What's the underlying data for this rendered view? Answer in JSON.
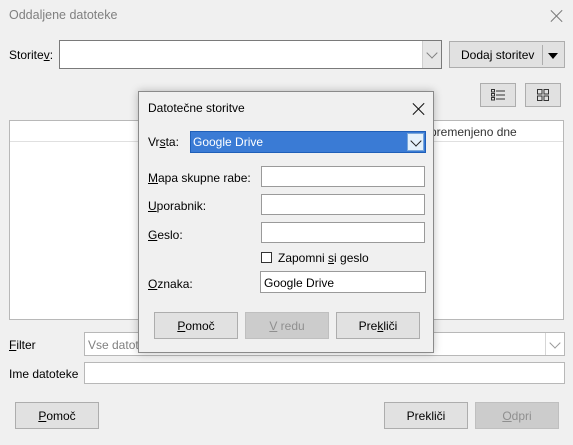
{
  "window": {
    "title": "Oddaljene datoteke"
  },
  "storage": {
    "label": "Storitev:",
    "value": "",
    "add_button": "Dodaj storitev"
  },
  "file_list": {
    "col_modified": "premenjeno dne"
  },
  "filter": {
    "label": "Filter",
    "value": "Vse datote"
  },
  "filename": {
    "label": "Ime datoteke",
    "value": ""
  },
  "bottom_buttons": {
    "help": "Pomoč",
    "cancel": "Prekliči",
    "open": "Odpri"
  },
  "dialog": {
    "title": "Datotečne storitve",
    "type_label": "Vrsta:",
    "type_value": "Google Drive",
    "share_label": "Mapa skupne rabe:",
    "share_value": "",
    "user_label": "Uporabnik:",
    "user_value": "",
    "password_label": "Geslo:",
    "password_value": "",
    "remember_label": "Zapomni si geslo",
    "remember_checked": false,
    "name_label": "Oznaka:",
    "name_value": "Google Drive",
    "help_button": "Pomoč",
    "ok_button": "V redu",
    "cancel_button": "Prekliči"
  },
  "colors": {
    "selection": "#3a7bd5",
    "background": "#f0f0f0"
  }
}
